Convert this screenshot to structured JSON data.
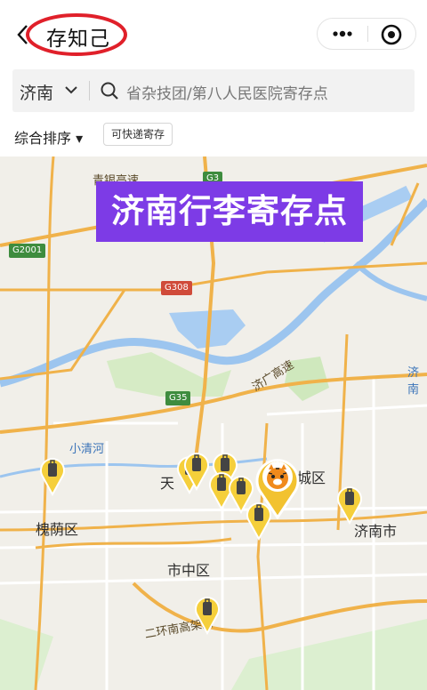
{
  "header": {
    "title": "存知己"
  },
  "search": {
    "city": "济南",
    "placeholder": "省杂技团/第八人民医院寄存点"
  },
  "filters": {
    "sort_label": "综合排序 ▾",
    "express_tag": "可快递寄存"
  },
  "map": {
    "banner": "济南行李寄存点",
    "places": {
      "huaiyin": "槐荫区",
      "jinan_city": "济南市",
      "shizhong": "市中区",
      "tian": "天",
      "chengqu": "城区",
      "jinan_right": "济南"
    },
    "roads": {
      "jiguang": "济广高速",
      "erhuan": "二环南高架路",
      "qingyin": "青银高速"
    },
    "water": {
      "xiaoqinghe": "小清河"
    },
    "shields": {
      "g2001": "G2001",
      "g308": "G308",
      "g35": "G35",
      "g3": "G3"
    }
  }
}
